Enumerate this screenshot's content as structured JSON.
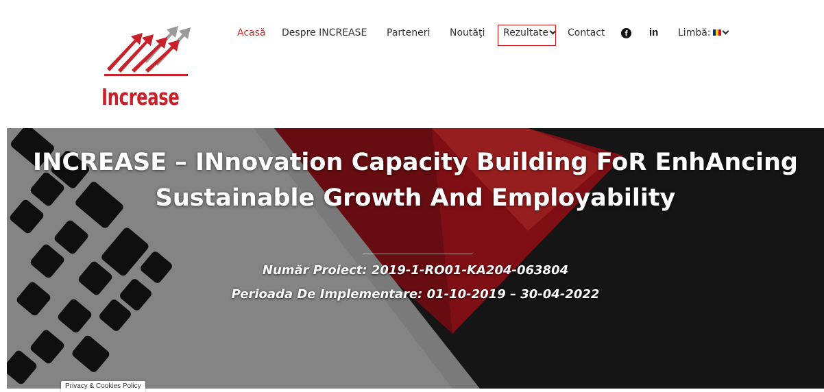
{
  "logo": {
    "text": "Increase"
  },
  "nav": {
    "items": [
      "Acasă",
      "Despre INCREASE",
      "Parteneri",
      "Noutăţi",
      "Rezultate",
      "Contact"
    ],
    "language_label": "Limbă:"
  },
  "social": {
    "facebook": "f",
    "linkedin": "in"
  },
  "hero": {
    "title": "INCREASE – INnovation Capacity Building FoR EnhAncing Sustainable Growth And Employability",
    "project_number": "Număr Proiect: 2019-1-RO01-KA204-063804",
    "period": "Perioada De Implementare: 01-10-2019 – 30-04-2022"
  },
  "cookie_tab": "Privacy & Cookies Policy",
  "colors": {
    "accent": "#d12a2a",
    "logo_red": "#c9212a",
    "logo_gray": "#9a9a9a"
  }
}
